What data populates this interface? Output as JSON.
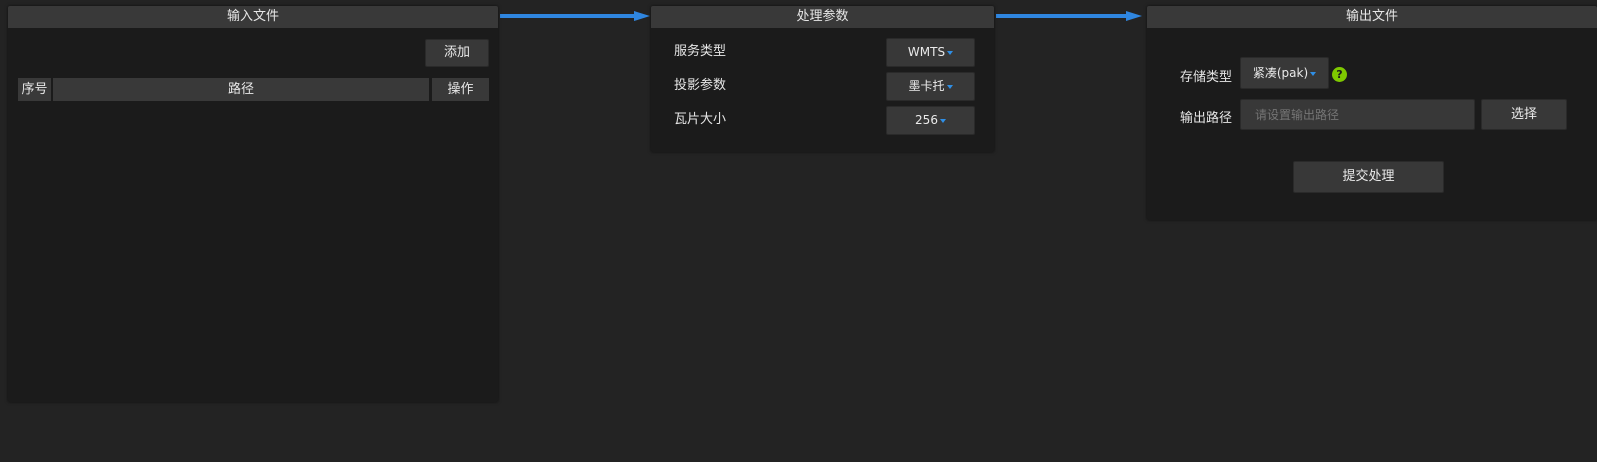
{
  "input_panel": {
    "title": "输入文件",
    "add_label": "添加",
    "columns": [
      "序号",
      "路径",
      "操作"
    ]
  },
  "params_panel": {
    "title": "处理参数",
    "rows": [
      {
        "label": "服务类型",
        "value": "WMTS"
      },
      {
        "label": "投影参数",
        "value": "墨卡托"
      },
      {
        "label": "瓦片大小",
        "value": "256"
      }
    ]
  },
  "output_panel": {
    "title": "输出文件",
    "storage_label": "存储类型",
    "storage_value": "紧凑(pak)",
    "path_label": "输出路径",
    "path_placeholder": "请设置输出路径",
    "choose_label": "选择",
    "submit_label": "提交处理"
  },
  "colors": {
    "arrow": "#2f86e0",
    "help_icon": "#7ec800"
  }
}
